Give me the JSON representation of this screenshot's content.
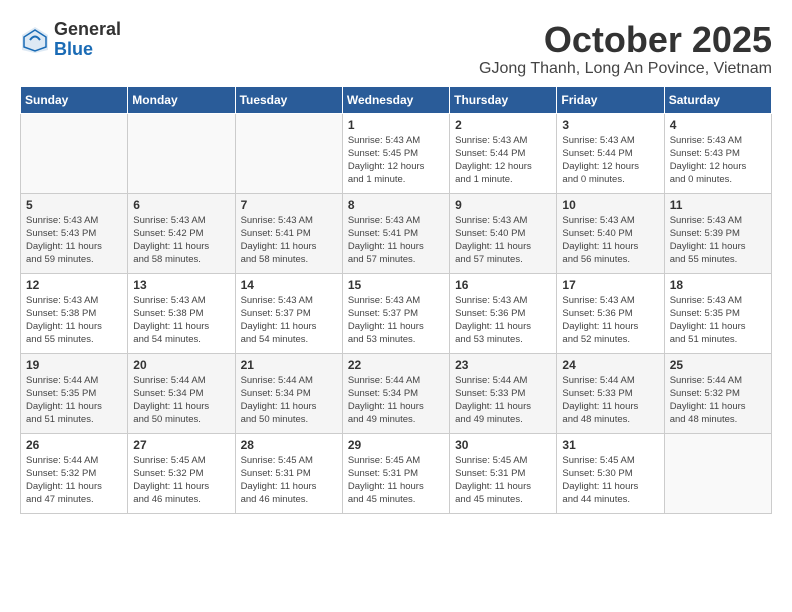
{
  "logo": {
    "general": "General",
    "blue": "Blue"
  },
  "header": {
    "month": "October 2025",
    "location": "GJong Thanh, Long An Povince, Vietnam"
  },
  "days_of_week": [
    "Sunday",
    "Monday",
    "Tuesday",
    "Wednesday",
    "Thursday",
    "Friday",
    "Saturday"
  ],
  "weeks": [
    [
      {
        "day": "",
        "info": ""
      },
      {
        "day": "",
        "info": ""
      },
      {
        "day": "",
        "info": ""
      },
      {
        "day": "1",
        "info": "Sunrise: 5:43 AM\nSunset: 5:45 PM\nDaylight: 12 hours\nand 1 minute."
      },
      {
        "day": "2",
        "info": "Sunrise: 5:43 AM\nSunset: 5:44 PM\nDaylight: 12 hours\nand 1 minute."
      },
      {
        "day": "3",
        "info": "Sunrise: 5:43 AM\nSunset: 5:44 PM\nDaylight: 12 hours\nand 0 minutes."
      },
      {
        "day": "4",
        "info": "Sunrise: 5:43 AM\nSunset: 5:43 PM\nDaylight: 12 hours\nand 0 minutes."
      }
    ],
    [
      {
        "day": "5",
        "info": "Sunrise: 5:43 AM\nSunset: 5:43 PM\nDaylight: 11 hours\nand 59 minutes."
      },
      {
        "day": "6",
        "info": "Sunrise: 5:43 AM\nSunset: 5:42 PM\nDaylight: 11 hours\nand 58 minutes."
      },
      {
        "day": "7",
        "info": "Sunrise: 5:43 AM\nSunset: 5:41 PM\nDaylight: 11 hours\nand 58 minutes."
      },
      {
        "day": "8",
        "info": "Sunrise: 5:43 AM\nSunset: 5:41 PM\nDaylight: 11 hours\nand 57 minutes."
      },
      {
        "day": "9",
        "info": "Sunrise: 5:43 AM\nSunset: 5:40 PM\nDaylight: 11 hours\nand 57 minutes."
      },
      {
        "day": "10",
        "info": "Sunrise: 5:43 AM\nSunset: 5:40 PM\nDaylight: 11 hours\nand 56 minutes."
      },
      {
        "day": "11",
        "info": "Sunrise: 5:43 AM\nSunset: 5:39 PM\nDaylight: 11 hours\nand 55 minutes."
      }
    ],
    [
      {
        "day": "12",
        "info": "Sunrise: 5:43 AM\nSunset: 5:38 PM\nDaylight: 11 hours\nand 55 minutes."
      },
      {
        "day": "13",
        "info": "Sunrise: 5:43 AM\nSunset: 5:38 PM\nDaylight: 11 hours\nand 54 minutes."
      },
      {
        "day": "14",
        "info": "Sunrise: 5:43 AM\nSunset: 5:37 PM\nDaylight: 11 hours\nand 54 minutes."
      },
      {
        "day": "15",
        "info": "Sunrise: 5:43 AM\nSunset: 5:37 PM\nDaylight: 11 hours\nand 53 minutes."
      },
      {
        "day": "16",
        "info": "Sunrise: 5:43 AM\nSunset: 5:36 PM\nDaylight: 11 hours\nand 53 minutes."
      },
      {
        "day": "17",
        "info": "Sunrise: 5:43 AM\nSunset: 5:36 PM\nDaylight: 11 hours\nand 52 minutes."
      },
      {
        "day": "18",
        "info": "Sunrise: 5:43 AM\nSunset: 5:35 PM\nDaylight: 11 hours\nand 51 minutes."
      }
    ],
    [
      {
        "day": "19",
        "info": "Sunrise: 5:44 AM\nSunset: 5:35 PM\nDaylight: 11 hours\nand 51 minutes."
      },
      {
        "day": "20",
        "info": "Sunrise: 5:44 AM\nSunset: 5:34 PM\nDaylight: 11 hours\nand 50 minutes."
      },
      {
        "day": "21",
        "info": "Sunrise: 5:44 AM\nSunset: 5:34 PM\nDaylight: 11 hours\nand 50 minutes."
      },
      {
        "day": "22",
        "info": "Sunrise: 5:44 AM\nSunset: 5:34 PM\nDaylight: 11 hours\nand 49 minutes."
      },
      {
        "day": "23",
        "info": "Sunrise: 5:44 AM\nSunset: 5:33 PM\nDaylight: 11 hours\nand 49 minutes."
      },
      {
        "day": "24",
        "info": "Sunrise: 5:44 AM\nSunset: 5:33 PM\nDaylight: 11 hours\nand 48 minutes."
      },
      {
        "day": "25",
        "info": "Sunrise: 5:44 AM\nSunset: 5:32 PM\nDaylight: 11 hours\nand 48 minutes."
      }
    ],
    [
      {
        "day": "26",
        "info": "Sunrise: 5:44 AM\nSunset: 5:32 PM\nDaylight: 11 hours\nand 47 minutes."
      },
      {
        "day": "27",
        "info": "Sunrise: 5:45 AM\nSunset: 5:32 PM\nDaylight: 11 hours\nand 46 minutes."
      },
      {
        "day": "28",
        "info": "Sunrise: 5:45 AM\nSunset: 5:31 PM\nDaylight: 11 hours\nand 46 minutes."
      },
      {
        "day": "29",
        "info": "Sunrise: 5:45 AM\nSunset: 5:31 PM\nDaylight: 11 hours\nand 45 minutes."
      },
      {
        "day": "30",
        "info": "Sunrise: 5:45 AM\nSunset: 5:31 PM\nDaylight: 11 hours\nand 45 minutes."
      },
      {
        "day": "31",
        "info": "Sunrise: 5:45 AM\nSunset: 5:30 PM\nDaylight: 11 hours\nand 44 minutes."
      },
      {
        "day": "",
        "info": ""
      }
    ]
  ]
}
